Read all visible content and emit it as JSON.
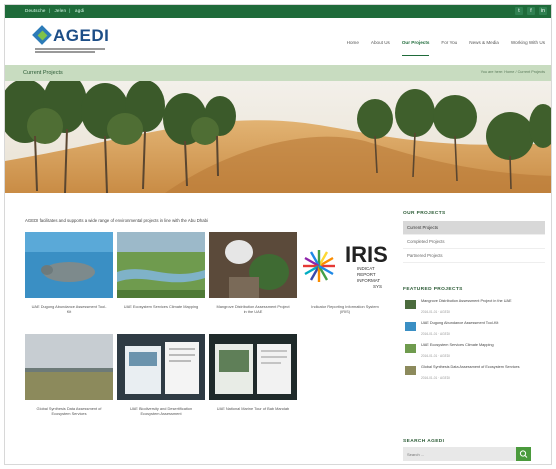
{
  "topbar": {
    "links": [
      "Deutsche",
      "Jelen",
      "agdi"
    ],
    "socials": [
      "twitter-icon",
      "facebook-icon",
      "linkedin-icon"
    ]
  },
  "brand": {
    "name": "AGEDI"
  },
  "nav": {
    "items": [
      "Home",
      "About Us",
      "Our Projects",
      "For You",
      "News & Media",
      "Working With Us"
    ],
    "active": 2
  },
  "page": {
    "title": "Current Projects",
    "breadcrumb": "You are here: Home / Current Projects",
    "intro": "AGEDI facilitates and supports a wide range of environmental projects in line with the Abu Dhabi"
  },
  "cards": [
    {
      "caption": "UAE Dugong Abundance Assessment Tool-Kit"
    },
    {
      "caption": "UAE Ecosystem Services Climate Mapping"
    },
    {
      "caption": "Mangrove Distribution Assessment Project in the UAE"
    },
    {
      "caption": "Indicator Reporting Information System (IRIS)"
    },
    {
      "caption": "Global Synthesis Data Assessment of Ecosystem Services"
    },
    {
      "caption": "UAE Biodiversity and Desertification Ecosystem Assessment"
    },
    {
      "caption": "UAE National Marine Tour of Bab Mandab"
    }
  ],
  "sidebar": {
    "projects_heading": "OUR PROJECTS",
    "projects": [
      "Current Projects",
      "Completed Projects",
      "Partnered Projects"
    ],
    "projects_active": 0,
    "featured_heading": "FEATURED PROJECTS",
    "featured": [
      {
        "title": "Mangrove Distribution Assessment Project in the UAE",
        "date": "2016-01-01 · AGEDI"
      },
      {
        "title": "UAE Dugong Abundance Assessment Tool-Kit",
        "date": "2016-01-01 · AGEDI"
      },
      {
        "title": "UAE Ecosystem Services Climate Mapping",
        "date": "2016-01-01 · AGEDI"
      },
      {
        "title": "Global Synthesis Data Assessment of Ecosystem Services",
        "date": "2016-01-01 · AGEDI"
      }
    ],
    "search_heading": "SEARCH AGEDI",
    "search_placeholder": "Search ..."
  },
  "iris": {
    "logo_text": "IRIS",
    "lines": [
      "INDICAT",
      "REPORT",
      "INFORMAT",
      "SYS"
    ]
  },
  "colors": {
    "brand_green": "#1f6b3a",
    "accent_green": "#4a9a3c",
    "title_bar": "#c8dcc0"
  }
}
